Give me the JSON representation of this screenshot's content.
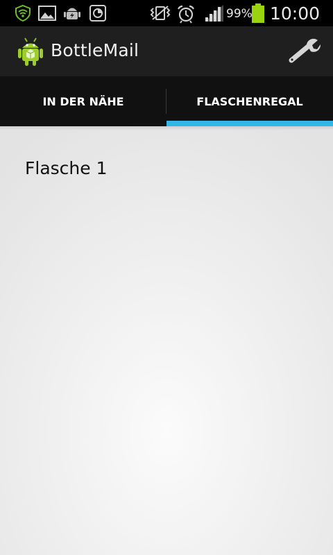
{
  "status_bar": {
    "icons": [
      "shield-wifi-icon",
      "picture-icon",
      "android-debug-icon",
      "clock-app-icon",
      "vibrate-icon",
      "alarm-icon",
      "signal-icon",
      "battery-icon"
    ],
    "battery_percent": "99%",
    "time": "10:00",
    "battery_color": "#9ad40e"
  },
  "action_bar": {
    "title": "BottleMail",
    "app_icon": "android-app-icon",
    "settings_icon": "wrench-icon"
  },
  "tabs": [
    {
      "label": "IN DER NÄHE",
      "selected": false
    },
    {
      "label": "FLASCHENREGAL",
      "selected": true
    }
  ],
  "accent_color": "#33b5e5",
  "content": {
    "items": [
      {
        "label": "Flasche 1"
      }
    ]
  }
}
